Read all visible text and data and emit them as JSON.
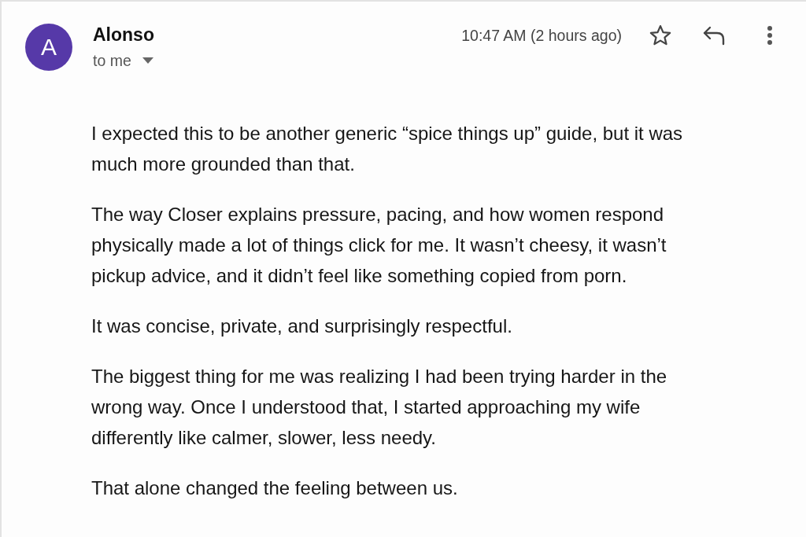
{
  "message": {
    "sender": {
      "avatar_letter": "A",
      "name": "Alonso"
    },
    "recipient": "to me",
    "time": "10:47 AM (2 hours ago)",
    "starred": false,
    "body": [
      "I expected this to be another generic “spice things up” guide, but it was much more grounded than that.",
      "The way Closer explains pressure, pacing, and how women respond physically made a lot of things click for me. It wasn’t cheesy, it wasn’t pickup advice, and it didn’t feel like something copied from porn.",
      "It was concise, private, and surprisingly respectful.",
      "The biggest thing for me was realizing I had been trying harder in the wrong way. Once I understood that, I started approaching my wife differently like calmer, slower, less needy.",
      "That alone changed the feeling between us."
    ]
  }
}
